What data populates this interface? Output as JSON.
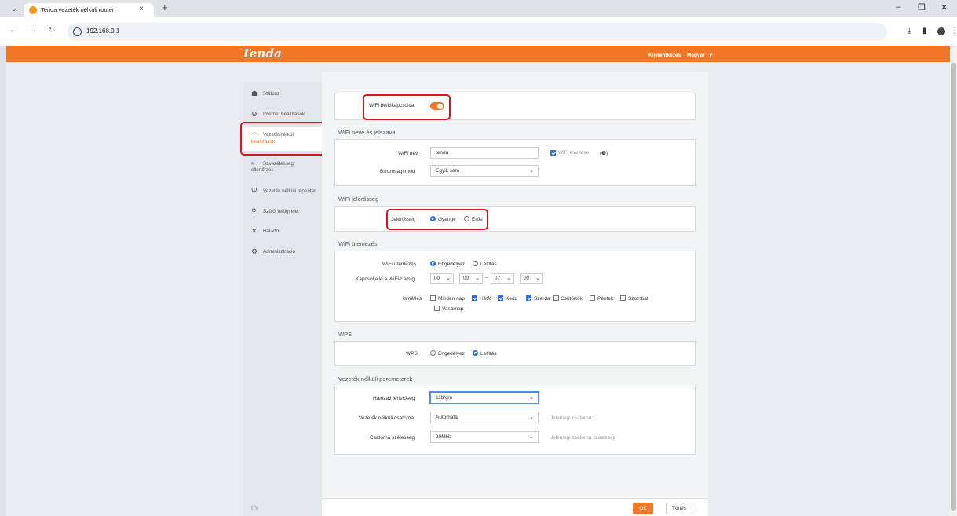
{
  "browser": {
    "tab_title": "Tenda vezeték nélküli router",
    "url": "192.168.0.1"
  },
  "header": {
    "logo": "Tenda",
    "logout": "Kijelentkezés",
    "language": "Magyar"
  },
  "sidebar": {
    "items": [
      {
        "label": "Státusz",
        "icon": "status-icon"
      },
      {
        "label": "Internet beállítások",
        "icon": "globe-icon"
      },
      {
        "label_line1": "Vezetéknélküli",
        "label_line2": "beállítások",
        "icon": "wifi-icon"
      },
      {
        "label_line1": "Sávszélesség",
        "label_line2": "ellenőrzés",
        "icon": "bandwidth-icon"
      },
      {
        "label": "Vezeték nélküli repeater",
        "icon": "antenna-icon"
      },
      {
        "label": "Szülői felügyelet",
        "icon": "family-icon"
      },
      {
        "label": "Haladó",
        "icon": "tools-icon"
      },
      {
        "label": "Adminisztráció",
        "icon": "gears-icon"
      }
    ],
    "social": "f  𝕏"
  },
  "wifi_toggle": {
    "label": "WiFi be/kikapcsolva",
    "on": true
  },
  "name_password": {
    "title": "WiFi neve és jelszava",
    "ssid_label": "WiFi név",
    "ssid_value": "tenda",
    "hide_label": "WiFi elrejtése",
    "hide_checked": true,
    "security_label": "Biztonsági mód",
    "security_value": "Egyik sem"
  },
  "signal": {
    "title": "WiFi jelerősség",
    "label": "Jelerősség",
    "opt_weak": "Gyenge",
    "opt_strong": "Erős",
    "selected": "Gyenge"
  },
  "schedule": {
    "title": "WiFi ütemezés",
    "label": "WiFi ütemezés",
    "opt_enable": "Engedélyez",
    "opt_disable": "Letiltás",
    "time_label": "Kapcsolja ki a WiFi-t amíg",
    "time": [
      "00",
      "00",
      "07",
      "00"
    ],
    "repeat_label": "Ismétlés",
    "days": [
      {
        "label": "Minden nap",
        "checked": false
      },
      {
        "label": "Hétfő",
        "checked": true
      },
      {
        "label": "Kedd",
        "checked": true
      },
      {
        "label": "Szerda",
        "checked": true
      },
      {
        "label": "Csütörtök",
        "checked": false
      },
      {
        "label": "Péntek",
        "checked": false
      },
      {
        "label": "Szombat",
        "checked": false
      },
      {
        "label": "Vasárnap",
        "checked": false
      }
    ]
  },
  "wps": {
    "title": "WPS",
    "label": "WPS",
    "opt_enable": "Engedélyez",
    "opt_disable": "Letiltás",
    "selected": "Letiltás"
  },
  "params": {
    "title": "Vezeték nélküli peremeterek",
    "mode_label": "Hálózati lehetőség",
    "mode_value": "11b/g/n",
    "channel_label": "Vezeték nélküli csatorna",
    "channel_value": "Automata",
    "channel_current": "Jelenlegi csatorna:",
    "width_label": "Csatorna szélesség",
    "width_value": "20MHz",
    "width_current": "Jelenlegi csatorna szélesség:"
  },
  "footer": {
    "ok": "OK",
    "cancel": "Törlés"
  },
  "colors": {
    "accent": "#f07628",
    "highlight": "#d9151b",
    "radio": "#2f6fe0"
  }
}
